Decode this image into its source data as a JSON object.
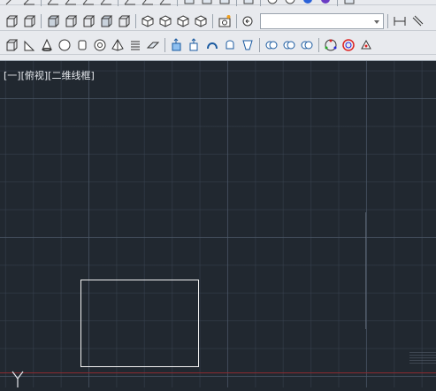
{
  "viewport": {
    "view_label": "[一][俯视][二维线框]",
    "ucs_label": "Y"
  },
  "toolbar": {
    "layer_dropdown_value": ""
  },
  "colors": {
    "background": "#212830",
    "grid_major": "#505c6c",
    "x_axis": "#8c2a30",
    "entity": "#f2f2f2",
    "toolbar": "#e8eaee"
  }
}
